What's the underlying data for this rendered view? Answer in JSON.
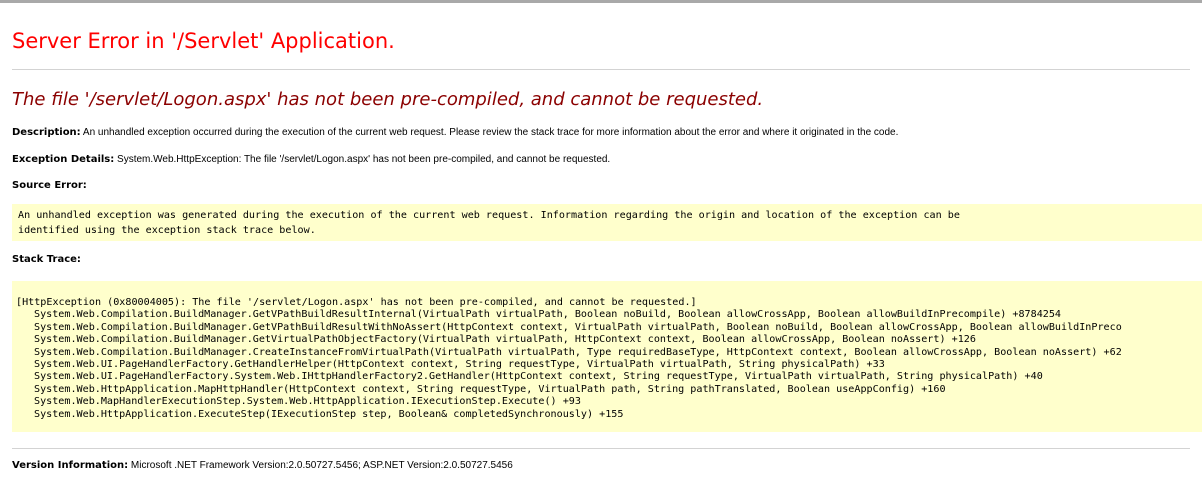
{
  "page": {
    "title": "Server Error in '/Servlet' Application.",
    "subtitle": "The file '/servlet/Logon.aspx' has not been pre-compiled, and cannot be requested."
  },
  "description": {
    "label": "Description:",
    "text": "An unhandled exception occurred during the execution of the current web request. Please review the stack trace for more information about the error and where it originated in the code."
  },
  "exception_details": {
    "label": "Exception Details:",
    "text": "System.Web.HttpException: The file '/servlet/Logon.aspx' has not been pre-compiled, and cannot be requested."
  },
  "source_error": {
    "label": "Source Error:",
    "lines": [
      "An unhandled exception was generated during the execution of the current web request. Information regarding the origin and location of the exception can be",
      "identified using the exception stack trace below."
    ]
  },
  "stack_trace": {
    "label": "Stack Trace:",
    "header": "[HttpException (0x80004005): The file '/servlet/Logon.aspx' has not been pre-compiled, and cannot be requested.]",
    "lines": [
      "System.Web.Compilation.BuildManager.GetVPathBuildResultInternal(VirtualPath virtualPath, Boolean noBuild, Boolean allowCrossApp, Boolean allowBuildInPrecompile) +8784254",
      "System.Web.Compilation.BuildManager.GetVPathBuildResultWithNoAssert(HttpContext context, VirtualPath virtualPath, Boolean noBuild, Boolean allowCrossApp, Boolean allowBuildInPreco",
      "System.Web.Compilation.BuildManager.GetVirtualPathObjectFactory(VirtualPath virtualPath, HttpContext context, Boolean allowCrossApp, Boolean noAssert) +126",
      "System.Web.Compilation.BuildManager.CreateInstanceFromVirtualPath(VirtualPath virtualPath, Type requiredBaseType, HttpContext context, Boolean allowCrossApp, Boolean noAssert) +62",
      "System.Web.UI.PageHandlerFactory.GetHandlerHelper(HttpContext context, String requestType, VirtualPath virtualPath, String physicalPath) +33",
      "System.Web.UI.PageHandlerFactory.System.Web.IHttpHandlerFactory2.GetHandler(HttpContext context, String requestType, VirtualPath virtualPath, String physicalPath) +40",
      "System.Web.HttpApplication.MapHttpHandler(HttpContext context, String requestType, VirtualPath path, String pathTranslated, Boolean useAppConfig) +160",
      "System.Web.MapHandlerExecutionStep.System.Web.HttpApplication.IExecutionStep.Execute() +93",
      "System.Web.HttpApplication.ExecuteStep(IExecutionStep step, Boolean& completedSynchronously) +155"
    ]
  },
  "version_info": {
    "label": "Version Information:",
    "text": "Microsoft .NET Framework Version:2.0.50727.5456; ASP.NET Version:2.0.50727.5456"
  },
  "colors": {
    "title": "#ff0000",
    "subtitle": "#8b0000",
    "code_background": "#ffffcc",
    "rule": "#d3d3d3"
  }
}
